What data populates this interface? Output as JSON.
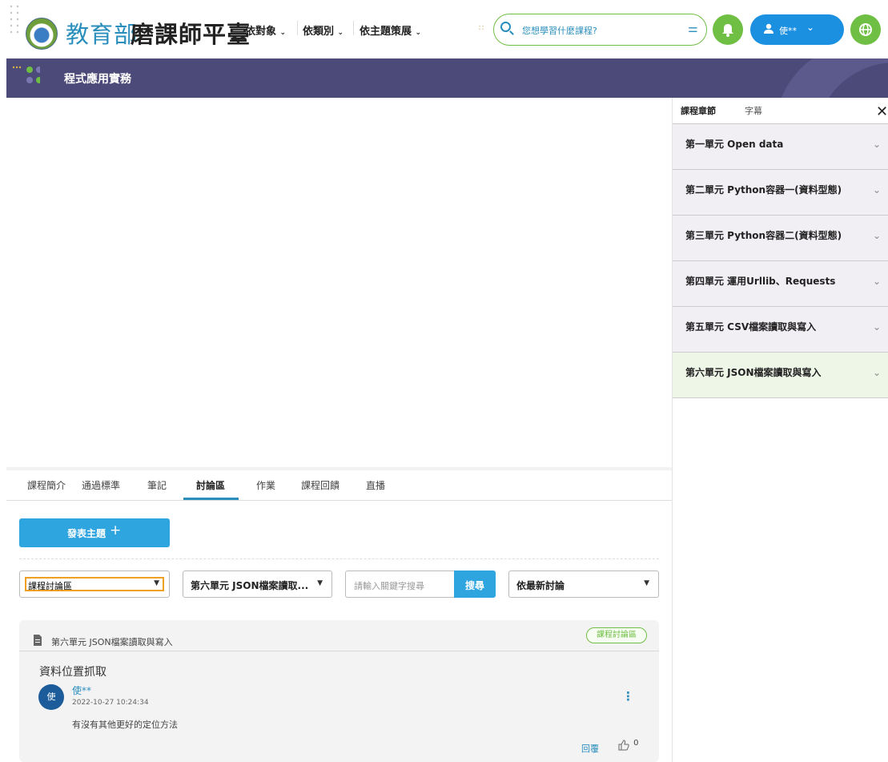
{
  "header": {
    "brand_primary": "教育部",
    "brand_secondary": "磨課師平臺",
    "nav": [
      {
        "label": "依對象"
      },
      {
        "label": "依類別"
      },
      {
        "label": "依主題策展"
      }
    ],
    "search_placeholder": "您想學習什麼課程?",
    "user_name": "使**",
    "colors": {
      "brand_blue": "#2a8ebd",
      "accent_green": "#6fbf44",
      "user_blue": "#1b8fe0"
    }
  },
  "course": {
    "title": "程式應用實務",
    "title_bar_color": "#4c4a78"
  },
  "sidebar": {
    "tabs": [
      "課程章節",
      "字幕"
    ],
    "active_tab": "課程章節",
    "chapters": [
      {
        "label": "第一單元 Open data"
      },
      {
        "label": "第二單元 Python容器一(資料型態)"
      },
      {
        "label": "第三單元 Python容器二(資料型態)"
      },
      {
        "label": "第四單元 運用Urllib、Requests"
      },
      {
        "label": "第五單元 CSV檔案讀取與寫入"
      },
      {
        "label": "第六單元 JSON檔案讀取與寫入",
        "active": true
      }
    ]
  },
  "course_tabs": [
    "課程簡介",
    "通過標準",
    "筆記",
    "討論區",
    "作業",
    "課程回饋",
    "直播"
  ],
  "active_course_tab": "討論區",
  "discussion": {
    "post_button": "發表主題",
    "filter_category": "課程討論區",
    "filter_unit": "第六單元 JSON檔案讀取...",
    "keyword_placeholder": "請輸入關鍵字搜尋",
    "search_button": "搜尋",
    "sort": "依最新討論",
    "post": {
      "unit": "第六單元 JSON檔案讀取與寫入",
      "badge": "課程討論區",
      "subject": "資料位置抓取",
      "avatar_text": "使",
      "author": "使**",
      "timestamp": "2022-10-27 10:24:34",
      "body": "有沒有其他更好的定位方法",
      "reply_label": "回覆",
      "likes": "0"
    }
  }
}
